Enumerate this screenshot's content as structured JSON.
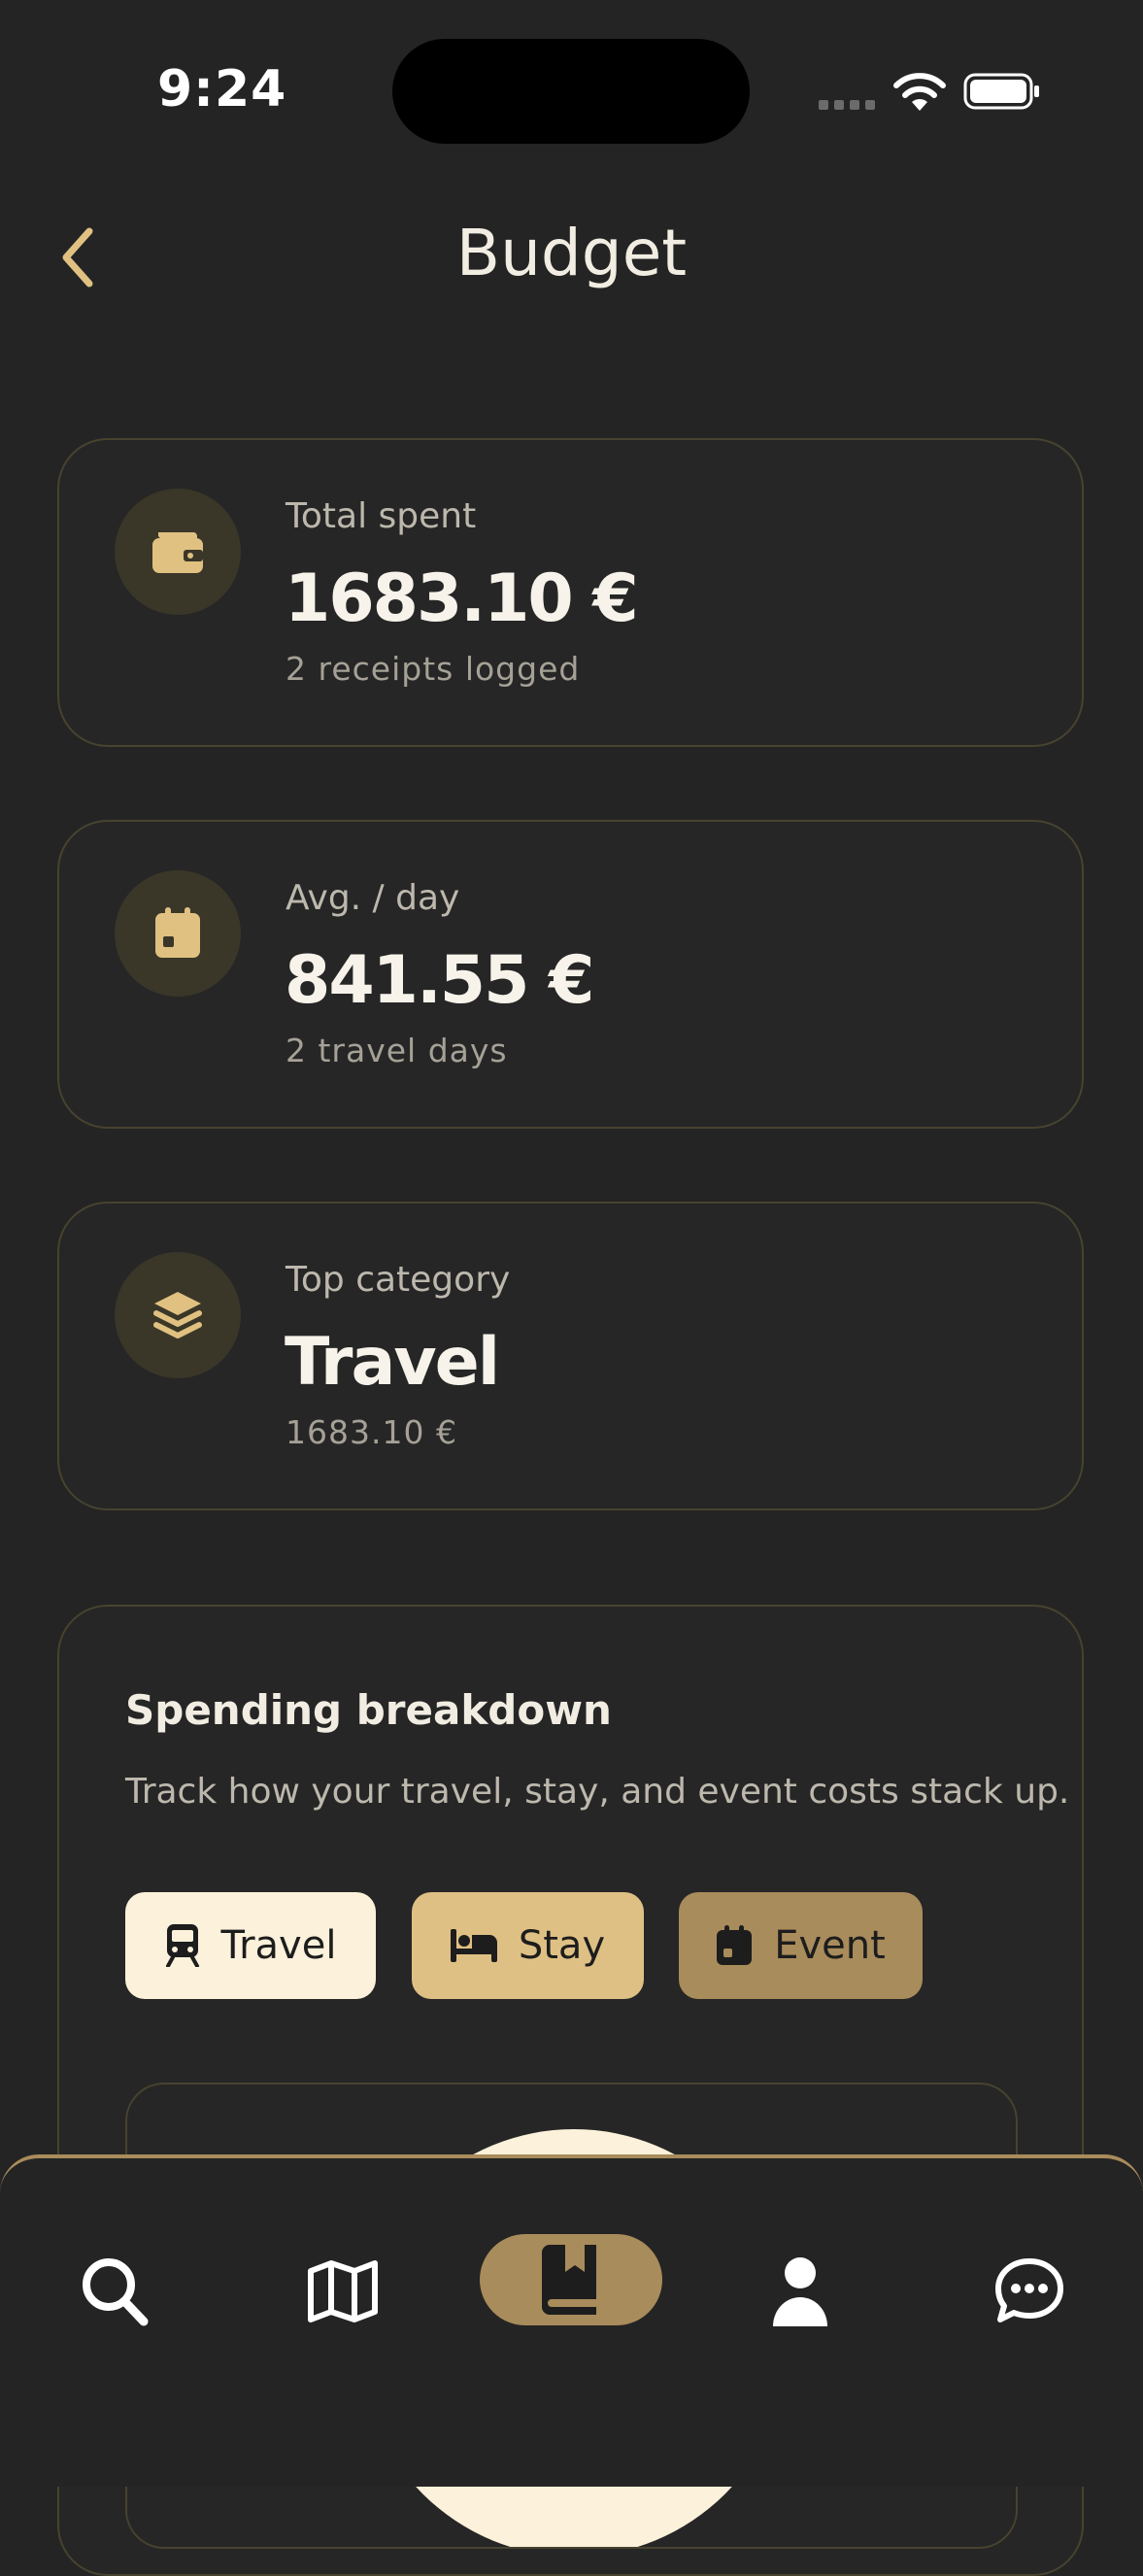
{
  "status_bar": {
    "time": "9:24"
  },
  "header": {
    "title": "Budget"
  },
  "stats": [
    {
      "icon": "wallet-icon",
      "label": "Total spent",
      "value": "1683.10 €",
      "sub": "2 receipts logged"
    },
    {
      "icon": "calendar-icon",
      "label": "Avg. / day",
      "value": "841.55 €",
      "sub": "2 travel days"
    },
    {
      "icon": "layers-icon",
      "label": "Top category",
      "value": "Travel",
      "sub": "1683.10 €"
    }
  ],
  "breakdown": {
    "title": "Spending breakdown",
    "description": "Track how your travel, stay, and event costs stack up.",
    "chips": [
      {
        "label": "Travel",
        "icon": "train-icon",
        "color": "#fcf1da"
      },
      {
        "label": "Stay",
        "icon": "bed-icon",
        "color": "#dfc084"
      },
      {
        "label": "Event",
        "icon": "calendar-icon",
        "color": "#a98c5b"
      }
    ]
  },
  "tab_bar": {
    "tabs": [
      {
        "icon": "search-icon",
        "active": false
      },
      {
        "icon": "map-icon",
        "active": false
      },
      {
        "icon": "book-bookmark-icon",
        "active": true
      },
      {
        "icon": "user-icon",
        "active": false
      },
      {
        "icon": "chat-icon",
        "active": false
      }
    ]
  },
  "colors": {
    "background": "#242424",
    "accent": "#a98c5b",
    "accent_light": "#dfc084",
    "accent_pale": "#fcf1da",
    "icon_gold": "#e0c181"
  }
}
